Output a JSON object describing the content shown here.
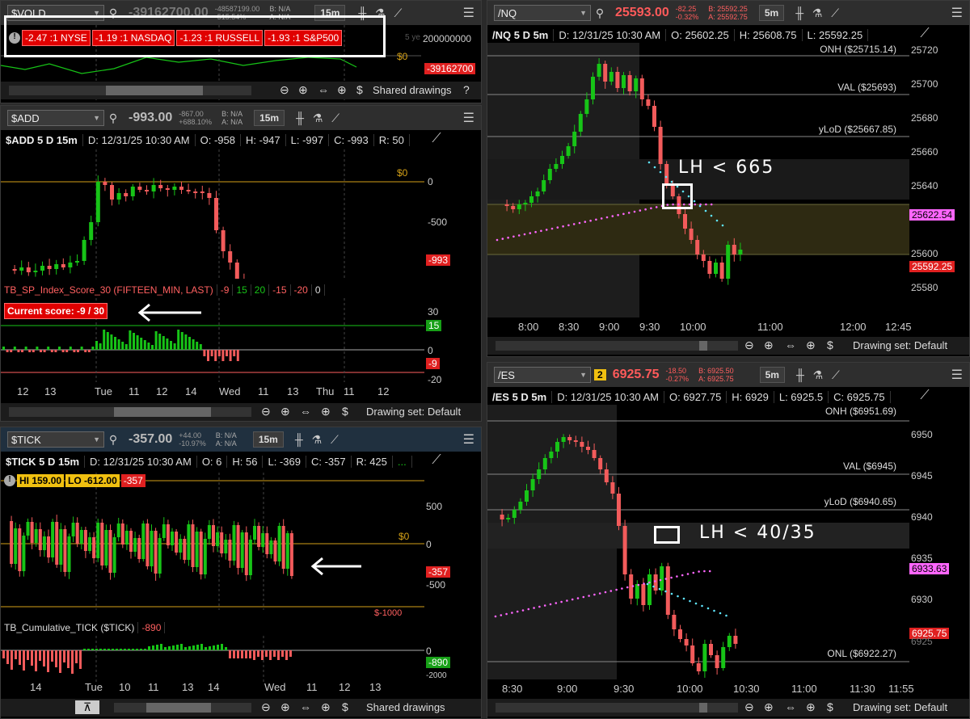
{
  "vold": {
    "symbol": "$VOLD",
    "last": "-39162700.00",
    "change": "-48587199.00",
    "change_pct": "-515.54%",
    "bid": "B: N/A",
    "ask": "A: N/A",
    "timeframe": "15m",
    "axis_top": "200000000",
    "zero_label": "$0",
    "last_tag": "-39162700",
    "faded_label": "5 ye",
    "breadth": [
      "-2.47 :1 NYSE",
      "-1.19 :1 NASDAQ",
      "-1.23 :1 RUSSELL",
      "-1.93 :1 S&P500"
    ],
    "footer_label": "Shared drawings"
  },
  "add": {
    "symbol": "$ADD",
    "last": "-993.00",
    "change": "-867.00",
    "change_pct": "+688.10%",
    "bid": "B: N/A",
    "ask": "A: N/A",
    "timeframe": "15m",
    "title": "$ADD 5 D 15m",
    "date": "D: 12/31/25 10:30 AM",
    "open": "O: -958",
    "high": "H: -947",
    "low": "L: -997",
    "close": "C: -993",
    "range": "R: 50",
    "zero_label": "$0",
    "axis": [
      "0",
      "-500"
    ],
    "last_tag": "-993",
    "study_title": "TB_SP_Index_Score_30 (FIFTEEN_MIN, LAST)",
    "study_values": [
      "-9",
      "15",
      "20",
      "-15",
      "-20",
      "0"
    ],
    "score_box": "Current score: -9 / 30",
    "study_axis": [
      "30",
      "0",
      "-20"
    ],
    "tag_15": "15",
    "tag_m9": "-9",
    "x_ticks": [
      "12",
      "13",
      "Tue",
      "11",
      "12",
      "14",
      "Wed",
      "11",
      "13",
      "Thu",
      "11",
      "12"
    ],
    "footer_label": "Drawing set: Default"
  },
  "tick": {
    "symbol": "$TICK",
    "last": "-357.00",
    "change": "+44.00",
    "change_pct": "-10.97%",
    "bid": "B: N/A",
    "ask": "A: N/A",
    "timeframe": "15m",
    "title": "$TICK 5 D 15m",
    "date": "D: 12/31/25 10:30 AM",
    "open": "O: 6",
    "high": "H: 56",
    "low": "L: -369",
    "close": "C: -357",
    "range": "R: 425",
    "more": "...",
    "hi": "HI 159.00",
    "lo": "LO -612.00",
    "cur": "-357",
    "axis": [
      "500",
      "0",
      "-500"
    ],
    "zero_label": "$0",
    "low_label": "$-1000",
    "last_tag": "-357",
    "study_title": "TB_Cumulative_TICK ($TICK)",
    "study_value": "-890",
    "study_axis": [
      "0",
      "-2000"
    ],
    "study_tag": "-890",
    "x_ticks": [
      "14",
      "Tue",
      "10",
      "11",
      "13",
      "14",
      "Wed",
      "11",
      "12",
      "13"
    ],
    "footer_label": "Shared drawings"
  },
  "nq": {
    "symbol": "/NQ",
    "last": "25593.00",
    "change": "-82.25",
    "change_pct": "-0.32%",
    "bid": "B: 25592.25",
    "ask": "A: 25592.75",
    "timeframe": "5m",
    "title": "/NQ 5 D 5m",
    "date": "D: 12/31/25 10:30 AM",
    "open": "O: 25602.25",
    "high": "H: 25608.75",
    "low": "L: 25592.25",
    "levels": [
      "ONH ($25715.14)",
      "VAL ($25693)",
      "yLoD ($25667.85)"
    ],
    "axis": [
      "25720",
      "25700",
      "25680",
      "25660",
      "25640",
      "25600",
      "25580"
    ],
    "tag_vwap": "25622.54",
    "tag_last": "25592.25",
    "annotation": "LH < 665",
    "x_ticks": [
      "8:00",
      "8:30",
      "9:00",
      "9:30",
      "10:00",
      "11:00",
      "12:00",
      "12:45"
    ],
    "footer_label": "Drawing set: Default"
  },
  "es": {
    "symbol": "/ES",
    "badge": "2",
    "last": "6925.75",
    "change": "-18.50",
    "change_pct": "-0.27%",
    "bid": "B: 6925.50",
    "ask": "A: 6925.75",
    "timeframe": "5m",
    "title": "/ES 5 D 5m",
    "date": "D: 12/31/25 10:30 AM",
    "open": "O: 6927.75",
    "high": "H: 6929",
    "low": "L: 6925.5",
    "close": "C: 6925.75",
    "levels": [
      "ONH ($6951.69)",
      "VAL ($6945)",
      "yLoD ($6940.65)",
      "ONL ($6922.27)"
    ],
    "axis": [
      "6950",
      "6945",
      "6940",
      "6935",
      "6930",
      "6925"
    ],
    "tag_vwap": "6933.63",
    "tag_last": "6925.75",
    "annotation": "LH < 40/35",
    "x_ticks": [
      "8:30",
      "9:00",
      "9:30",
      "10:00",
      "10:30",
      "11:00",
      "11:30",
      "11:55"
    ],
    "footer_label": "Drawing set: Default"
  },
  "colors": {
    "up": "#17c417",
    "down": "#f25b5b",
    "vwap": "#ff66ff",
    "level": "#d4a017"
  }
}
